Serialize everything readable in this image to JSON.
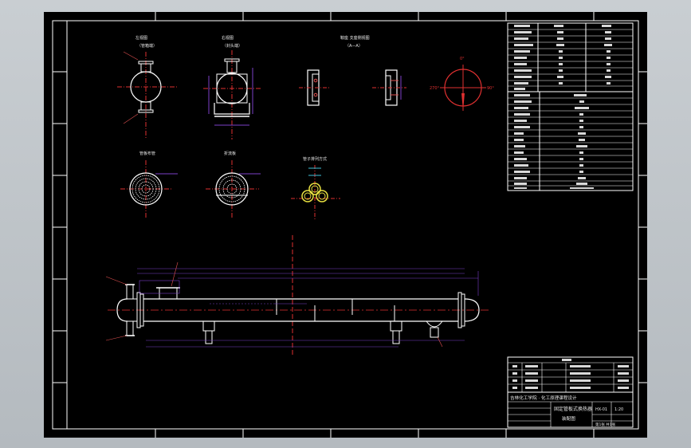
{
  "drawing": {
    "title_block": {
      "school": "吉林化工学院 · 化工原理课程设计",
      "drawing_title": "固定管板式换热器",
      "subtitle": "装配图",
      "drawing_no": "HX-01",
      "scale": "1:20",
      "sheet": "第1张 共1张"
    },
    "views": {
      "left_end_view": "左视图",
      "left_end_sub": "（管箱端）",
      "right_end_view": "右视图",
      "right_end_sub": "（封头端）",
      "saddle_view": "鞍座 支座侧视图",
      "saddle_sub": "（A—A）",
      "tube_layout": "管板布管",
      "baffle_view": "折流板",
      "tube_arrangement": "管子排列方式",
      "main_view": "主视图"
    }
  },
  "colors": {
    "background": "#000000",
    "lines": "#ffffff",
    "dimension": "#7b3fc8",
    "centerline": "#e03030",
    "tube_ring": "#e8e040",
    "cyan": "#40c0d8"
  }
}
